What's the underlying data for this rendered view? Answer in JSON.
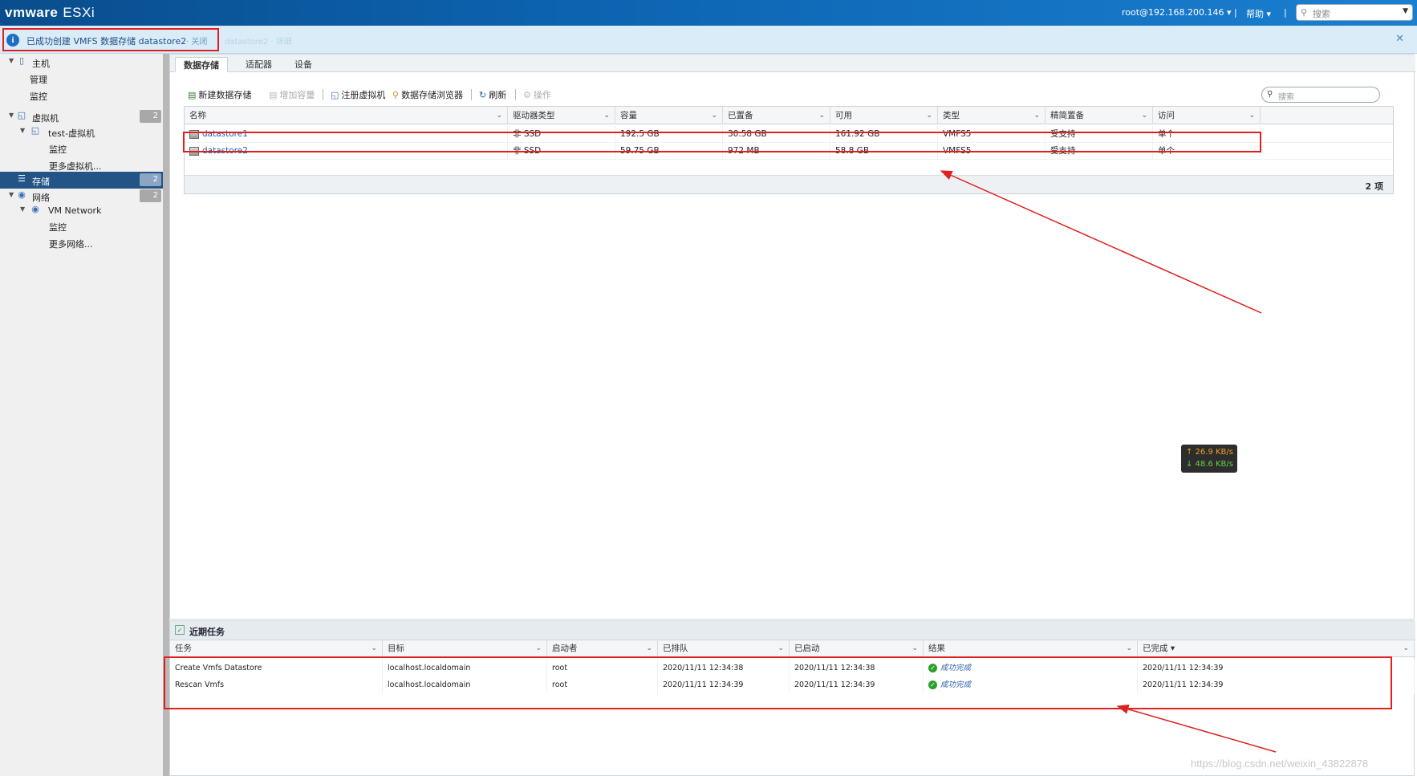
{
  "app": {
    "brand": "vmware",
    "product": "ESXi"
  },
  "topbar": {
    "user": "root@192.168.200.146 ▾",
    "sep": "|",
    "help": "帮助 ▾",
    "search_placeholder": "搜索"
  },
  "notification": {
    "message": "已成功创建 VMFS 数据存储 datastore2",
    "close_label": "· 关闭",
    "faded": "datastore2 · 详细"
  },
  "sidebar": {
    "host": "主机",
    "manage": "管理",
    "monitor": "监控",
    "vms": "虚拟机",
    "vms_count": "2",
    "vm_name": "test-虚拟机",
    "vm_monitor": "监控",
    "more_vms": "更多虚拟机...",
    "storage": "存储",
    "storage_count": "2",
    "network": "网络",
    "network_count": "2",
    "vm_network": "VM Network",
    "net_monitor": "监控",
    "more_networks": "更多网络..."
  },
  "tabs": [
    "数据存储",
    "适配器",
    "设备"
  ],
  "toolbar": {
    "new_datastore": "新建数据存储",
    "increase_capacity": "增加容量",
    "register_vm": "注册虚拟机",
    "datastore_browser": "数据存储浏览器",
    "refresh": "刷新",
    "actions": "操作",
    "search_placeholder": "搜索"
  },
  "grid": {
    "columns": [
      "名称",
      "驱动器类型",
      "容量",
      "已置备",
      "可用",
      "类型",
      "精简置备",
      "访问"
    ],
    "rows": [
      [
        "datastore1",
        "非 SSD",
        "192.5 GB",
        "30.58 GB",
        "161.92 GB",
        "VMFS5",
        "受支持",
        "单个"
      ],
      [
        "datastore2",
        "非 SSD",
        "59.75 GB",
        "972 MB",
        "58.8 GB",
        "VMFS5",
        "受支持",
        "单个"
      ]
    ],
    "count": "2 项"
  },
  "speed": {
    "up": "↑ 26.9 KB/s",
    "down": "↓ 48.6 KB/s"
  },
  "tasks": {
    "title": "近期任务",
    "columns": [
      "任务",
      "目标",
      "启动者",
      "已排队",
      "已启动",
      "结果",
      "已完成 ▾"
    ],
    "rows": [
      [
        "Create Vmfs Datastore",
        "localhost.localdomain",
        "root",
        "2020/11/11 12:34:38",
        "2020/11/11 12:34:38",
        "成功完成",
        "2020/11/11 12:34:39"
      ],
      [
        "Rescan Vmfs",
        "localhost.localdomain",
        "root",
        "2020/11/11 12:34:39",
        "2020/11/11 12:34:39",
        "成功完成",
        "2020/11/11 12:34:39"
      ]
    ]
  },
  "watermark": "https://blog.csdn.net/weixin_43822878",
  "colors": {
    "topbar": "#0c63b0",
    "active_nav": "#225486",
    "highlight": "#e02020"
  }
}
